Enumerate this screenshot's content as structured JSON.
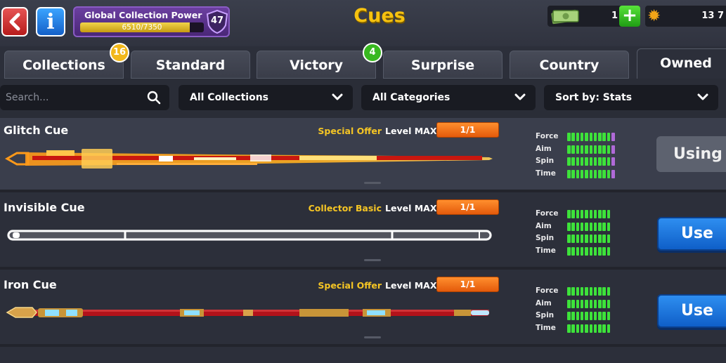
{
  "header": {
    "title": "Cues",
    "info_label": "i",
    "collection_power": {
      "label": "Global Collection Power",
      "value_text": "6510/7350",
      "fraction": 0.886,
      "level": "47"
    },
    "cash": {
      "value": "1",
      "add_label": "+"
    },
    "coins": {
      "value": "13 7"
    }
  },
  "tabs": [
    {
      "label": "Collections",
      "badge": "16",
      "badge_color": "#f2b81b"
    },
    {
      "label": "Standard"
    },
    {
      "label": "Victory",
      "badge": "4",
      "badge_color": "#38b820"
    },
    {
      "label": "Surprise"
    },
    {
      "label": "Country"
    },
    {
      "label": "Owned",
      "active": true
    }
  ],
  "filters": {
    "search_placeholder": "Search...",
    "collections": "All Collections",
    "categories": "All Categories",
    "sort": "Sort by: Stats"
  },
  "stat_labels": [
    "Force",
    "Aim",
    "Spin",
    "Time"
  ],
  "cues": [
    {
      "name": "Glitch Cue",
      "offer": "Special Offer",
      "level": "Level MAX",
      "count": "1/1",
      "action": "Using",
      "stats": [
        10,
        10,
        10,
        10
      ],
      "stat_max": 11,
      "bonus_color": "#b06ad8"
    },
    {
      "name": "Invisible Cue",
      "offer": "Collector Basic",
      "level": "Level MAX",
      "count": "1/1",
      "action": "Use",
      "stats": [
        10,
        10,
        10,
        10
      ],
      "stat_max": 10
    },
    {
      "name": "Iron Cue",
      "offer": "Special Offer",
      "level": "Level MAX",
      "count": "1/1",
      "action": "Use",
      "stats": [
        10,
        10,
        10,
        10
      ],
      "stat_max": 10
    }
  ],
  "colors": {
    "accent_title": "#f6c20f",
    "offer_text": "#f5c524",
    "count_badge": "#f07a1c",
    "stat_green": "#3de23a",
    "use_button": "#1f78e0"
  }
}
